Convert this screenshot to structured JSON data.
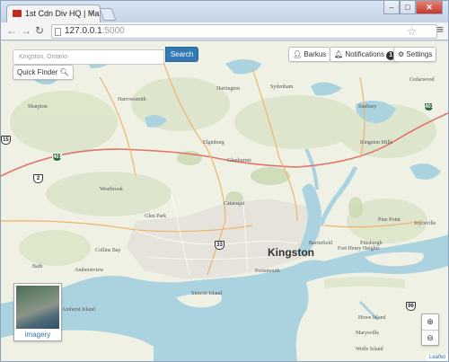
{
  "browser": {
    "tab_title": "1st Cdn Div HQ | Ma",
    "tab_close": "×",
    "window_buttons": [
      "–",
      "□",
      "✕"
    ],
    "url_host": "127.0.0.1",
    "url_port": ":5000"
  },
  "search": {
    "placeholder": "Kingston, Ontario",
    "button_label": "Search"
  },
  "quick_finder": {
    "label": "Quick Finder"
  },
  "header_buttons": {
    "user": "Barkus",
    "notifications": "Notifications",
    "notifications_count": "1",
    "settings": "Settings"
  },
  "layer_switcher": {
    "label": "imagery"
  },
  "zoom": {
    "in": "+",
    "out": "−"
  },
  "attribution": "Leaflet",
  "icons": {
    "user": "user-icon",
    "bell": "bell-icon",
    "gear": "gear-icon",
    "search": "search-icon"
  },
  "colors": {
    "water": "#aad3df",
    "primary_button": "#3279b5",
    "highway": "#e07468"
  },
  "map": {
    "city": "Kingston",
    "highways": [
      "401",
      "401",
      "2",
      "33",
      "96",
      "15"
    ],
    "places": [
      "Sharpton",
      "Harrowsmith",
      "Hartington",
      "Sydenham",
      "Glenburnie",
      "Kingston Mills",
      "Elginburg",
      "Westbrook",
      "Collins Bay",
      "Amherstview",
      "Bath",
      "Barriefield",
      "Pittsburgh",
      "Cataraqui",
      "Portsmouth",
      "Fort Henry Heights",
      "Amherst Island",
      "Wolfe Island",
      "Pine Point",
      "Marysville",
      "Cedarwood",
      "Sunbury",
      "Joyceville",
      "Glen Park",
      "Howe Island",
      "Simcoe Island"
    ]
  }
}
